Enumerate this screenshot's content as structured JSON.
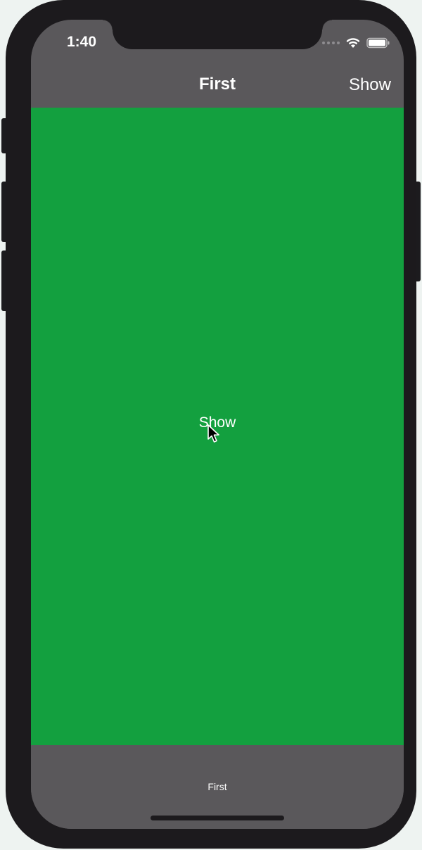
{
  "status_bar": {
    "time": "1:40",
    "icons": [
      "cellular-signal-icon",
      "wifi-icon",
      "battery-icon"
    ]
  },
  "nav_bar": {
    "title": "First",
    "right_button_label": "Show"
  },
  "content": {
    "background_color": "#13a03f",
    "center_button_label": "Show"
  },
  "tab_bar": {
    "items": [
      {
        "label": "First"
      }
    ]
  },
  "colors": {
    "bar_background": "#5a585b",
    "device_frame": "#1c1a1d",
    "text": "#ffffff"
  }
}
